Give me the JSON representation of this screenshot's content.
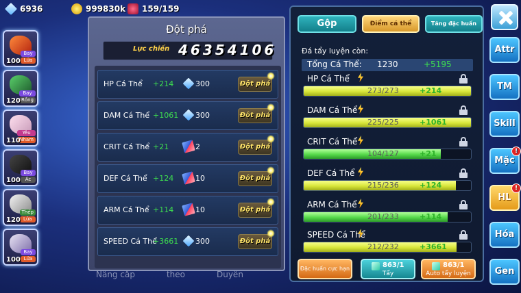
{
  "resources": {
    "diamonds": "6936",
    "gold": "999830k",
    "energy": "159/159"
  },
  "team": [
    {
      "level": "100",
      "tags": [
        "Bay",
        "Lửa"
      ]
    },
    {
      "level": "120",
      "tags": [
        "Bay",
        "Rồng"
      ]
    },
    {
      "level": "110",
      "tags": [
        "Yêu",
        "Nham"
      ]
    },
    {
      "level": "100",
      "tags": [
        "Bay",
        "Ác"
      ]
    },
    {
      "level": "120",
      "tags": [
        "Thép",
        "Lửa"
      ]
    },
    {
      "level": "100",
      "tags": [
        "Bay",
        "Lửa"
      ]
    }
  ],
  "breakthrough": {
    "title": "Đột phá",
    "power_label": "Lực chiến",
    "power_value": "46354106",
    "button_label": "Đột phá",
    "rows": [
      {
        "name": "HP Cá Thể",
        "bonus": "+214",
        "cost_icon": "diamond-icon",
        "cost": "300"
      },
      {
        "name": "DAM Cá Thể",
        "bonus": "+1061",
        "cost_icon": "diamond-icon",
        "cost": "300"
      },
      {
        "name": "CRIT Cá Thể",
        "bonus": "+21",
        "cost_icon": "book-icon",
        "cost": "2"
      },
      {
        "name": "DEF Cá Thể",
        "bonus": "+124",
        "cost_icon": "book-icon",
        "cost": "10"
      },
      {
        "name": "ARM Cá Thể",
        "bonus": "+114",
        "cost_icon": "book-icon",
        "cost": "10"
      },
      {
        "name": "SPEED Cá Thể",
        "bonus": "+3661",
        "cost_icon": "diamond-icon",
        "cost": "300"
      }
    ]
  },
  "under_nav": [
    "Nâng cấp",
    "theo",
    "Duyên"
  ],
  "stats_panel": {
    "tabs": [
      "Gộp",
      "Điểm cá thể",
      "Tăng đặc huấn"
    ],
    "remaining_label": "Đá tẩy luyện còn:",
    "total_label": "Tổng Cá Thể:",
    "total_value": "1230",
    "total_bonus": "+5195",
    "stats": [
      {
        "name": "HP Cá Thể",
        "current": 273,
        "max": 273,
        "text": "273/273",
        "bonus": "+214",
        "color": "yellow"
      },
      {
        "name": "DAM Cá Thể",
        "current": 225,
        "max": 225,
        "text": "225/225",
        "bonus": "+1061",
        "color": "yellow"
      },
      {
        "name": "CRIT Cá Thể",
        "current": 104,
        "max": 127,
        "text": "104/127",
        "bonus": "+21",
        "color": "green"
      },
      {
        "name": "DEF Cá Thể",
        "current": 215,
        "max": 236,
        "text": "215/236",
        "bonus": "+124",
        "color": "yellow"
      },
      {
        "name": "ARM Cá Thể",
        "current": 201,
        "max": 233,
        "text": "201/233",
        "bonus": "+114",
        "color": "green"
      },
      {
        "name": "SPEED Cá Thể",
        "current": 212,
        "max": 232,
        "text": "212/232",
        "bonus": "+3661",
        "color": "yellow"
      }
    ],
    "buttons": {
      "special": "Đặc huấn cực hạn",
      "wash_count": "863/1",
      "wash_label": "Tẩy",
      "auto_count": "863/1",
      "auto_label": "Auto tẩy luyện"
    }
  },
  "side_menu": [
    {
      "label": "Attr",
      "badge": ""
    },
    {
      "label": "TM",
      "badge": ""
    },
    {
      "label": "Skill",
      "badge": ""
    },
    {
      "label": "Mặc",
      "badge": "!"
    },
    {
      "label": "HL",
      "badge": "!"
    },
    {
      "label": "Hóa",
      "badge": ""
    },
    {
      "label": "Gen",
      "badge": ""
    }
  ],
  "colors": {
    "bonus_green": "#3ee04f",
    "gold_text": "#ffe46a",
    "tab_active": "#e5a73a",
    "accent_teal": "#1f9aa5"
  }
}
